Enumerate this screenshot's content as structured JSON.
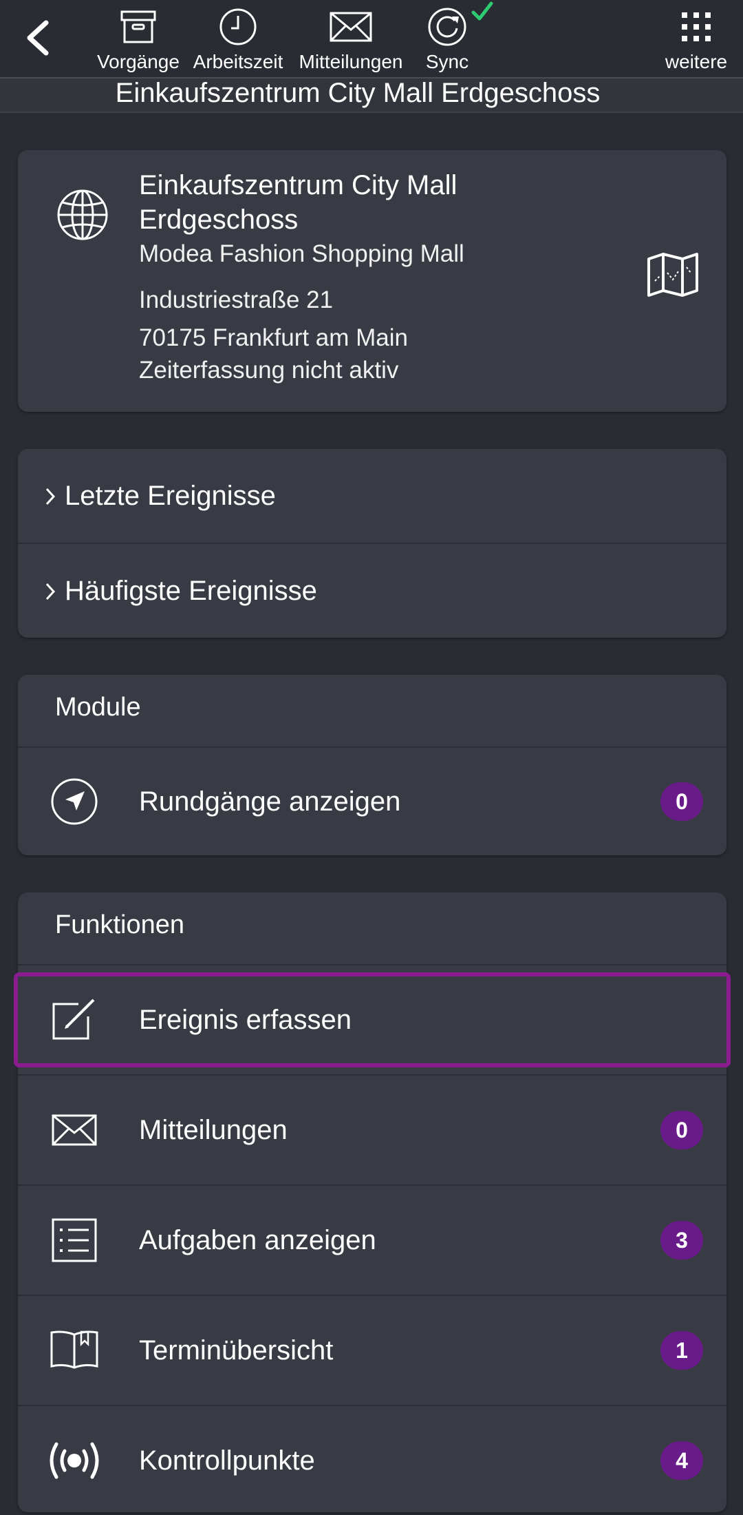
{
  "toolbar": {
    "items": [
      {
        "label": "Vorgänge",
        "icon": "archive-icon"
      },
      {
        "label": "Arbeitszeit",
        "icon": "clock-icon"
      },
      {
        "label": "Mitteilungen",
        "icon": "mail-icon"
      },
      {
        "label": "Sync",
        "icon": "sync-icon"
      },
      {
        "label": "weitere",
        "icon": "grid-menu-icon"
      }
    ]
  },
  "header": {
    "title": "Einkaufszentrum City Mall Erdgeschoss"
  },
  "location": {
    "name_line1": "Einkaufszentrum City Mall",
    "name_line2": "Erdgeschoss",
    "customer": "Modea Fashion Shopping Mall",
    "street": "Industriestraße 21",
    "city": "70175 Frankfurt am Main",
    "time_tracking": "Zeiterfassung nicht aktiv"
  },
  "events": {
    "recent": "Letzte Ereignisse",
    "frequent": "Häufigste Ereignisse"
  },
  "modules": {
    "title": "Module",
    "items": [
      {
        "label": "Rundgänge anzeigen",
        "badge": "0",
        "icon": "navigation-arrow-icon"
      }
    ]
  },
  "functions": {
    "title": "Funktionen",
    "items": [
      {
        "label": "Ereignis erfassen",
        "icon": "edit-note-icon"
      },
      {
        "label": "Mitteilungen",
        "badge": "0",
        "icon": "mail-icon"
      },
      {
        "label": "Aufgaben anzeigen",
        "badge": "3",
        "icon": "list-icon"
      },
      {
        "label": "Terminübersicht",
        "badge": "1",
        "icon": "book-bookmark-icon"
      },
      {
        "label": "Kontrollpunkte",
        "badge": "4",
        "icon": "nfc-signal-icon"
      }
    ]
  },
  "colors": {
    "background": "#2a2c34",
    "card": "#393b44",
    "badge": "#6a1b8a",
    "highlight": "#8a1c8f",
    "sync_check": "#2ecc71"
  }
}
